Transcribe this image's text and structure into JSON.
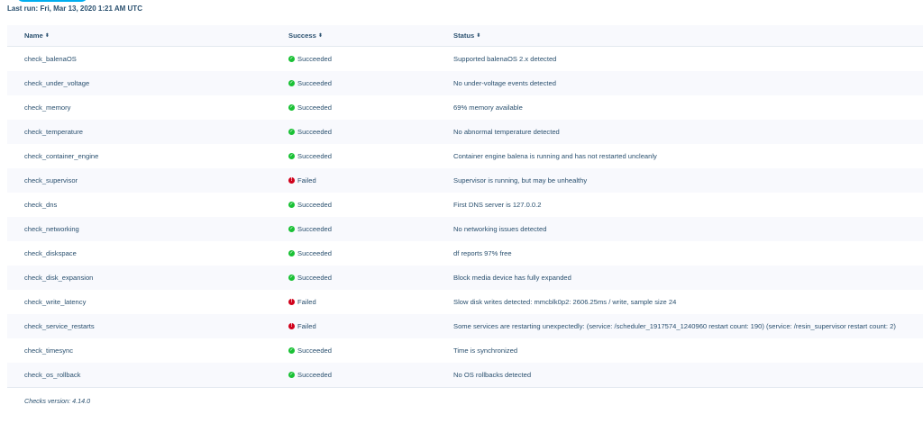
{
  "last_run": "Last run: Fri, Mar 13, 2020 1:21 AM UTC",
  "table": {
    "columns": [
      "Name",
      "Success",
      "Status"
    ],
    "rows": [
      {
        "name": "check_balenaOS",
        "success": "Succeeded",
        "ok": true,
        "status": "Supported balenaOS 2.x detected"
      },
      {
        "name": "check_under_voltage",
        "success": "Succeeded",
        "ok": true,
        "status": "No under-voltage events detected"
      },
      {
        "name": "check_memory",
        "success": "Succeeded",
        "ok": true,
        "status": "69% memory available"
      },
      {
        "name": "check_temperature",
        "success": "Succeeded",
        "ok": true,
        "status": "No abnormal temperature detected"
      },
      {
        "name": "check_container_engine",
        "success": "Succeeded",
        "ok": true,
        "status": "Container engine balena is running and has not restarted uncleanly"
      },
      {
        "name": "check_supervisor",
        "success": "Failed",
        "ok": false,
        "status": "Supervisor is running, but may be unhealthy"
      },
      {
        "name": "check_dns",
        "success": "Succeeded",
        "ok": true,
        "status": "First DNS server is 127.0.0.2"
      },
      {
        "name": "check_networking",
        "success": "Succeeded",
        "ok": true,
        "status": "No networking issues detected"
      },
      {
        "name": "check_diskspace",
        "success": "Succeeded",
        "ok": true,
        "status": "df reports 97% free"
      },
      {
        "name": "check_disk_expansion",
        "success": "Succeeded",
        "ok": true,
        "status": "Block media device has fully expanded"
      },
      {
        "name": "check_write_latency",
        "success": "Failed",
        "ok": false,
        "status": "Slow disk writes detected: mmcblk0p2: 2606.25ms / write, sample size 24"
      },
      {
        "name": "check_service_restarts",
        "success": "Failed",
        "ok": false,
        "status": "Some services are restarting unexpectedly: (service: /scheduler_1917574_1240960 restart count: 190) (service: /resin_supervisor restart count: 2)"
      },
      {
        "name": "check_timesync",
        "success": "Succeeded",
        "ok": true,
        "status": "Time is synchronized"
      },
      {
        "name": "check_os_rollback",
        "success": "Succeeded",
        "ok": true,
        "status": "No OS rollbacks detected"
      }
    ]
  },
  "footer": "Checks version: 4.14.0",
  "colors": {
    "success": "#1ac135",
    "failed": "#d0011b",
    "accent": "#00aeef",
    "text": "#2a506f"
  },
  "icons": {
    "sort": "sort-icon",
    "success": "check-circle-icon",
    "failed": "exclamation-circle-icon"
  }
}
